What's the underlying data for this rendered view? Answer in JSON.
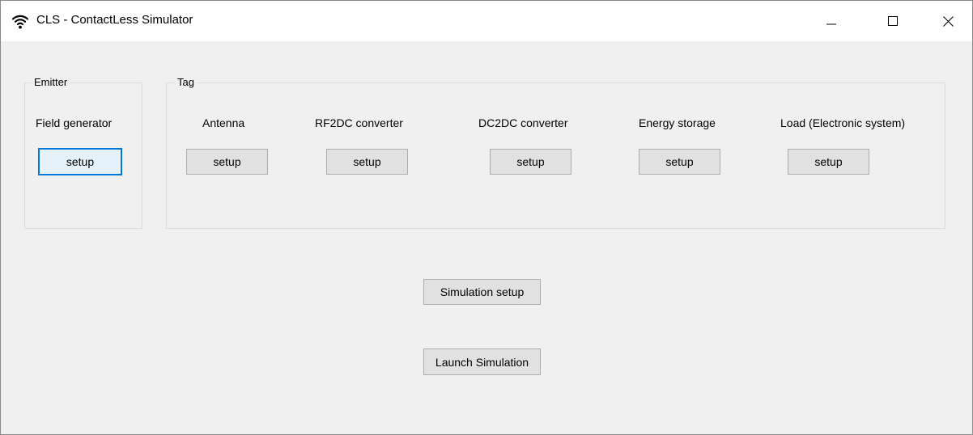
{
  "window": {
    "title": "CLS - ContactLess Simulator",
    "app_icon": "wifi-icon",
    "controls": {
      "minimize_icon": "minimize-icon",
      "maximize_icon": "maximize-icon",
      "close_icon": "close-icon"
    }
  },
  "emitter": {
    "legend": "Emitter",
    "field_generator": {
      "label": "Field generator",
      "button": "setup"
    }
  },
  "tag": {
    "legend": "Tag",
    "antenna": {
      "label": "Antenna",
      "button": "setup"
    },
    "rf2dc": {
      "label": "RF2DC converter",
      "button": "setup"
    },
    "dc2dc": {
      "label": "DC2DC converter",
      "button": "setup"
    },
    "energy_storage": {
      "label": "Energy storage",
      "button": "setup"
    },
    "load": {
      "label": "Load (Electronic system)",
      "button": "setup"
    }
  },
  "actions": {
    "simulation_setup": "Simulation setup",
    "launch_simulation": "Launch Simulation"
  },
  "colors": {
    "focus_border": "#0078d7",
    "button_face": "#e1e1e1",
    "window_bg": "#f0f0f0"
  }
}
